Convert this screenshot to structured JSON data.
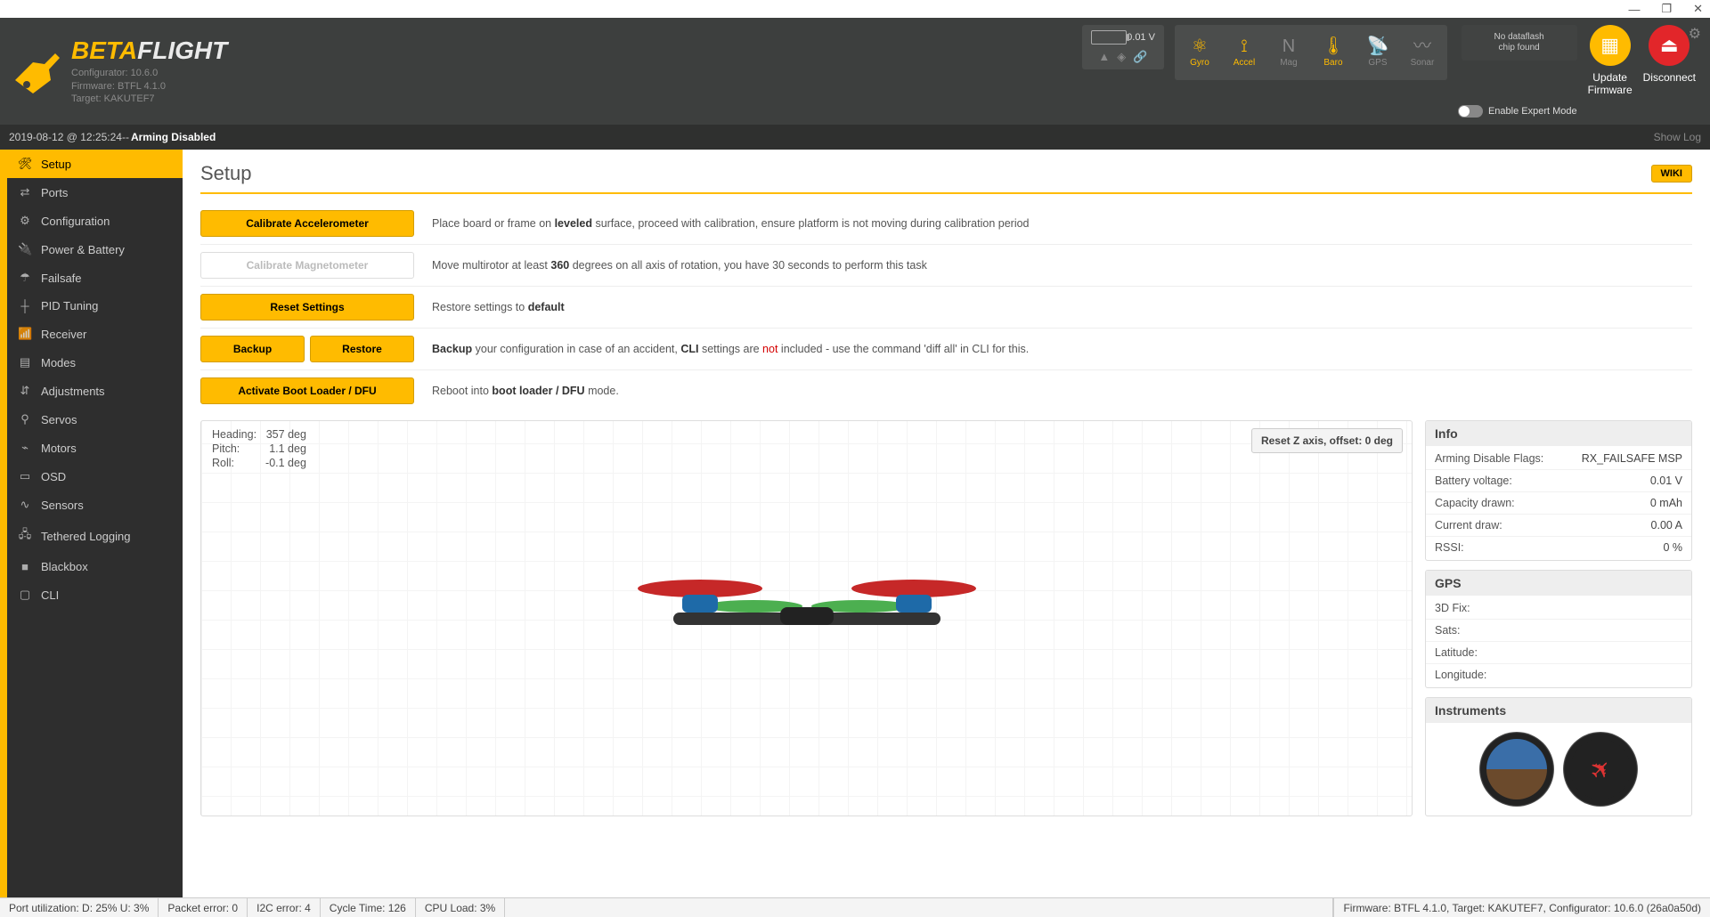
{
  "titlebar": {
    "minimize": "—",
    "maximize": "❐",
    "close": "✕"
  },
  "logo": {
    "beta": "BETA",
    "flight": "FLIGHT"
  },
  "versions": {
    "configurator": "Configurator: 10.6.0",
    "firmware": "Firmware: BTFL 4.1.0",
    "target": "Target: KAKUTEF7"
  },
  "battery": {
    "voltage": "0.01 V"
  },
  "sensors": [
    {
      "label": "Gyro",
      "icon": "⚛",
      "on": true
    },
    {
      "label": "Accel",
      "icon": "⟟",
      "on": true
    },
    {
      "label": "Mag",
      "icon": "N",
      "on": false
    },
    {
      "label": "Baro",
      "icon": "🌡",
      "on": true
    },
    {
      "label": "GPS",
      "icon": "📡",
      "on": false
    },
    {
      "label": "Sonar",
      "icon": "〰",
      "on": false
    }
  ],
  "dataflash": "No dataflash\nchip found",
  "expert_label": "Enable Expert Mode",
  "buttons": {
    "update": "Update\nFirmware",
    "disconnect": "Disconnect"
  },
  "armbar": {
    "ts": "2019-08-12 @ 12:25:24",
    "sep": " -- ",
    "status": "Arming Disabled",
    "showlog": "Show Log"
  },
  "nav": [
    {
      "icon": "🛠",
      "label": "Setup",
      "active": true
    },
    {
      "icon": "⇄",
      "label": "Ports"
    },
    {
      "icon": "⚙",
      "label": "Configuration"
    },
    {
      "icon": "🔌",
      "label": "Power & Battery"
    },
    {
      "icon": "☂",
      "label": "Failsafe"
    },
    {
      "icon": "┼",
      "label": "PID Tuning"
    },
    {
      "icon": "📶",
      "label": "Receiver"
    },
    {
      "icon": "▤",
      "label": "Modes"
    },
    {
      "icon": "⇵",
      "label": "Adjustments"
    },
    {
      "icon": "⚲",
      "label": "Servos"
    },
    {
      "icon": "⌁",
      "label": "Motors"
    },
    {
      "icon": "▭",
      "label": "OSD"
    },
    {
      "icon": "∿",
      "label": "Sensors"
    },
    {
      "icon": "🖧",
      "label": "Tethered Logging"
    },
    {
      "icon": "■",
      "label": "Blackbox"
    },
    {
      "icon": "▢",
      "label": "CLI"
    }
  ],
  "page": {
    "title": "Setup",
    "wiki": "WIKI"
  },
  "rows": {
    "calib_accel": {
      "btn": "Calibrate Accelerometer",
      "desc_pre": "Place board or frame on ",
      "b1": "leveled",
      "desc_post": " surface, proceed with calibration, ensure platform is not moving during calibration period"
    },
    "calib_mag": {
      "btn": "Calibrate Magnetometer",
      "desc_pre": "Move multirotor at least ",
      "b1": "360",
      "desc_post": " degrees on all axis of rotation, you have 30 seconds to perform this task"
    },
    "reset": {
      "btn": "Reset Settings",
      "desc_pre": "Restore settings to ",
      "b1": "default"
    },
    "backup": {
      "btn1": "Backup",
      "btn2": "Restore",
      "d1": "Backup",
      "d2": " your configuration in case of an accident, ",
      "d3": "CLI",
      "d4": " settings are ",
      "d5": "not",
      "d6": " included - use the command 'diff all' in CLI for this."
    },
    "dfu": {
      "btn": "Activate Boot Loader / DFU",
      "desc_pre": "Reboot into ",
      "b1": "boot loader / DFU",
      "desc_post": " mode."
    }
  },
  "attitude": {
    "heading_l": "Heading:",
    "heading_v": "357 deg",
    "pitch_l": "Pitch:",
    "pitch_v": "1.1 deg",
    "roll_l": "Roll:",
    "roll_v": "-0.1 deg"
  },
  "resetz": "Reset Z axis, offset: 0 deg",
  "info": {
    "title": "Info",
    "rows": [
      {
        "l": "Arming Disable Flags:",
        "v": "RX_FAILSAFE  MSP"
      },
      {
        "l": "Battery voltage:",
        "v": "0.01 V"
      },
      {
        "l": "Capacity drawn:",
        "v": "0 mAh"
      },
      {
        "l": "Current draw:",
        "v": "0.00 A"
      },
      {
        "l": "RSSI:",
        "v": "0 %"
      }
    ]
  },
  "gps": {
    "title": "GPS",
    "rows": [
      {
        "l": "3D Fix:",
        "v": ""
      },
      {
        "l": "Sats:",
        "v": ""
      },
      {
        "l": "Latitude:",
        "v": ""
      },
      {
        "l": "Longitude:",
        "v": ""
      }
    ]
  },
  "instruments": {
    "title": "Instruments"
  },
  "status": {
    "port": "Port utilization: D: 25% U: 3%",
    "packet": "Packet error: 0",
    "i2c": "I2C error: 4",
    "cycle": "Cycle Time: 126",
    "cpu": "CPU Load: 3%",
    "right": "Firmware: BTFL 4.1.0, Target: KAKUTEF7, Configurator: 10.6.0 (26a0a50d)"
  }
}
